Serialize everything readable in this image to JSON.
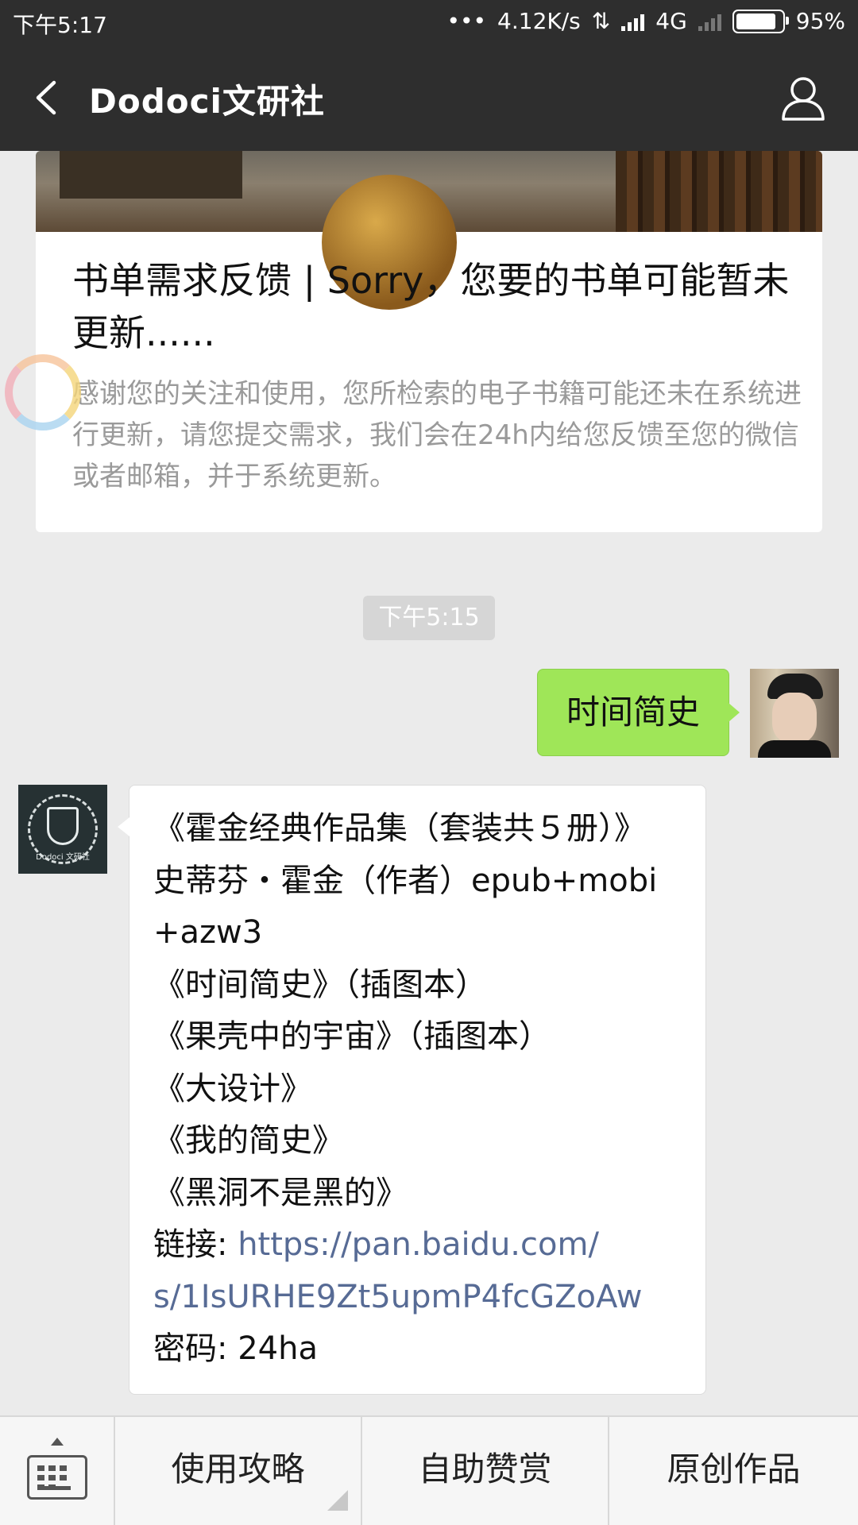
{
  "status_bar": {
    "time": "下午5:17",
    "dots": "•••",
    "speed": "4.12K/s",
    "network": "4G",
    "battery": "95%",
    "battery_level": 0.95
  },
  "header": {
    "title": "Dodoci文研社"
  },
  "article_card": {
    "title": "书单需求反馈 | Sorry，您要的书单可能暂未更新......",
    "description": "感谢您的关注和使用，您所检索的电子书籍可能还未在系统进行更新，请您提交需求，我们会在24h内给您反馈至您的微信或者邮箱，并于系统更新。"
  },
  "chat": {
    "time_separator": "下午5:15",
    "my_message": "时间简史",
    "reply": {
      "lines": [
        "《霍金经典作品集（套装共５册）》",
        "史蒂芬・霍金（作者）epub+mobi",
        "+azw3",
        "《时间简史》（插图本）",
        "《果壳中的宇宙》（插图本）",
        "《大设计》",
        "《我的简史》",
        "《黑洞不是黑的》"
      ],
      "link_label": "链接: ",
      "link_line1": "https://pan.baidu.com/",
      "link_line2": "s/1IsURHE9Zt5upmP4fcGZoAw",
      "password": "密码: 24ha"
    },
    "bot_avatar_label": "Dodoci 文研社"
  },
  "bottom_menu": {
    "items": [
      "使用攻略",
      "自助赞赏",
      "原创作品"
    ]
  },
  "colors": {
    "bar": "#2e2e2e",
    "my_bubble": "#9fe658",
    "link": "#576b95",
    "background": "#ebebeb"
  }
}
